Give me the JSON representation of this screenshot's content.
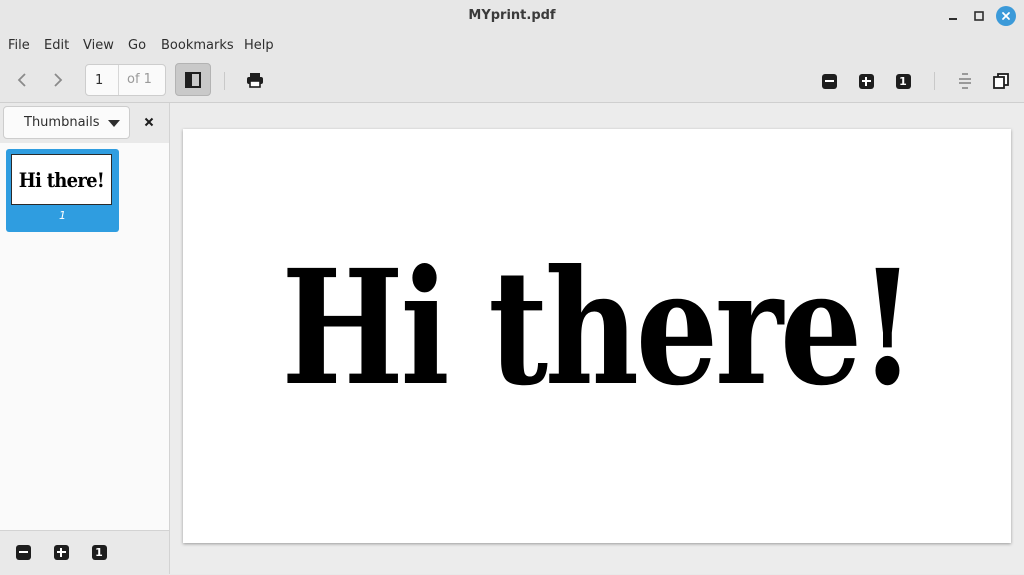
{
  "window": {
    "title": "MYprint.pdf"
  },
  "menu": {
    "items": [
      "File",
      "Edit",
      "View",
      "Go",
      "Bookmarks",
      "Help"
    ]
  },
  "toolbar": {
    "page_value": "1",
    "page_of": "of 1",
    "zoom_out_icon": "minus-square-icon",
    "zoom_in_icon": "plus-square-icon",
    "actual_size_label": "1"
  },
  "sidebar": {
    "mode": "Thumbnails",
    "thumbnail": {
      "text": "Hi there!",
      "page_label": "1"
    },
    "footer_actual_size_label": "1",
    "selected_color": "#2f9de0"
  },
  "document": {
    "text": "Hi there!"
  },
  "colors": {
    "accent": "#3b9ad9",
    "selection": "#2f9de0"
  }
}
